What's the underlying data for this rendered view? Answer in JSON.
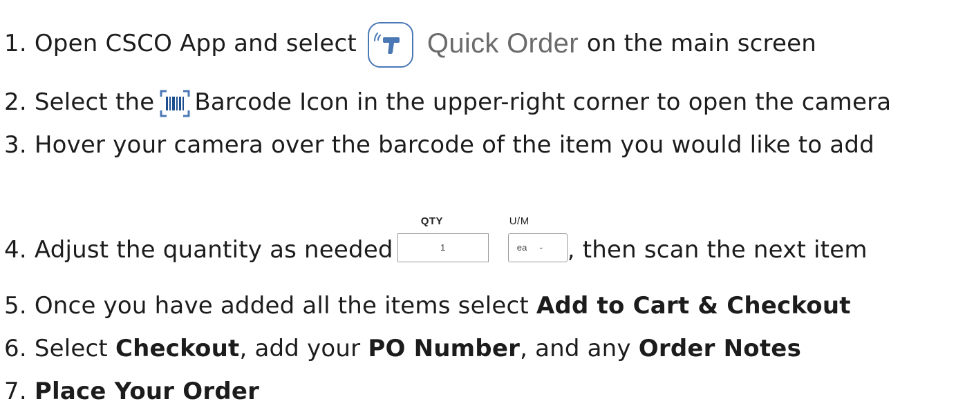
{
  "steps": {
    "s1": {
      "pre": "1. Open CSCO App and select",
      "app_name": "Quick Order",
      "post": "on the main screen",
      "icon": "scanner-gun-icon"
    },
    "s2": {
      "pre": "2. Select the",
      "post": "Barcode Icon in the upper-right corner to open the camera",
      "icon": "barcode-icon"
    },
    "s3": {
      "text": "3. Hover your camera over the barcode of the item you would like to add"
    },
    "s4": {
      "pre": "4. Adjust the quantity as needed",
      "qty_label": "QTY",
      "qty_value": "1",
      "um_label": "U/M",
      "um_value": "ea",
      "post": ", then scan the next item"
    },
    "s5": {
      "pre": "5. Once you have added all the items select ",
      "bold": "Add to Cart & Checkout"
    },
    "s6": {
      "pre": "6. Select ",
      "bold1": "Checkout",
      "mid1": ", add your ",
      "bold2": "PO Number",
      "mid2": ", and any ",
      "bold3": "Order Notes"
    },
    "s7": {
      "pre": "7. ",
      "bold": "Place Your Order"
    }
  },
  "colors": {
    "icon_blue": "#4a78b5",
    "app_name_gray": "#6b6b6b",
    "text": "#1c1c1c"
  }
}
